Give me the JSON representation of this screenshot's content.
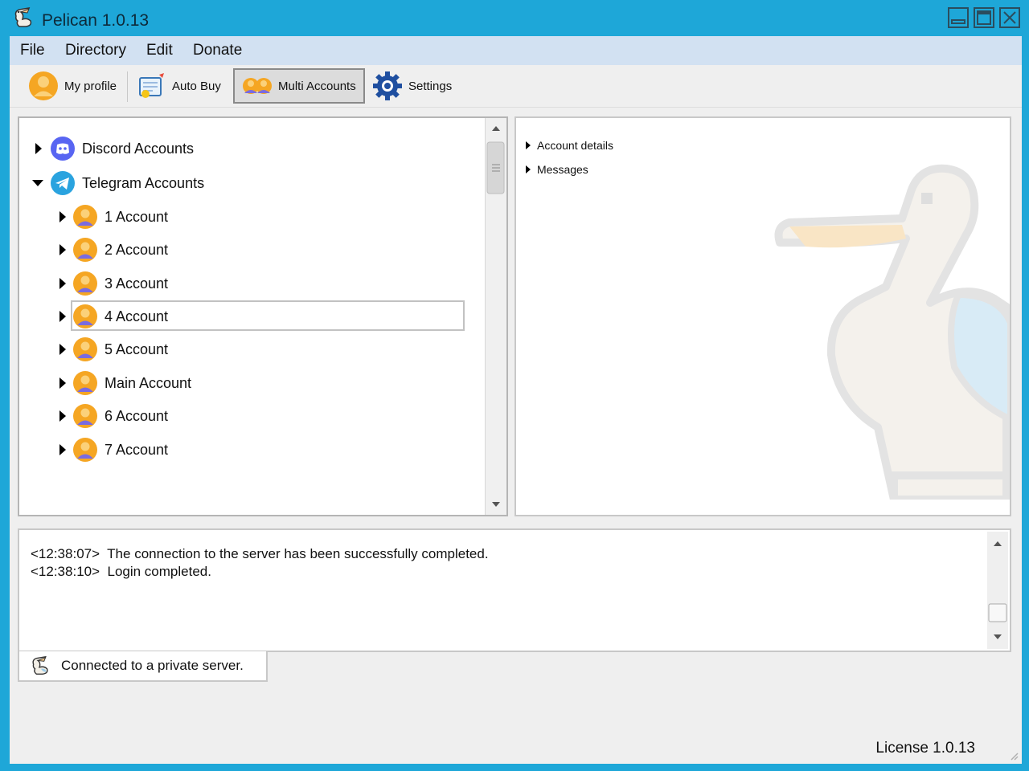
{
  "window": {
    "title": "Pelican 1.0.13"
  },
  "menu": {
    "file": "File",
    "directory": "Directory",
    "edit": "Edit",
    "donate": "Donate"
  },
  "toolbar": {
    "my_profile": "My profile",
    "auto_buy": "Auto Buy",
    "multi_accounts": "Multi Accounts",
    "settings": "Settings"
  },
  "tree": {
    "discord": "Discord Accounts",
    "telegram": "Telegram Accounts",
    "accounts": [
      "1 Account",
      "2 Account",
      "3 Account",
      "4 Account",
      "5 Account",
      "Main Account",
      "6 Account",
      "7 Account"
    ]
  },
  "details": {
    "account_details": "Account details",
    "messages": "Messages"
  },
  "log": [
    {
      "time": "<12:38:07>",
      "text": "The connection to the server has been successfully completed."
    },
    {
      "time": "<12:38:10>",
      "text": "Login completed."
    }
  ],
  "status": {
    "text": "Connected to a private server."
  },
  "license": "License 1.0.13",
  "colors": {
    "titlebar": "#1ea7d8",
    "menubar": "#d2e1f2",
    "discord": "#5865f2",
    "telegram": "#2aa3df",
    "avatar": "#f5a623"
  }
}
